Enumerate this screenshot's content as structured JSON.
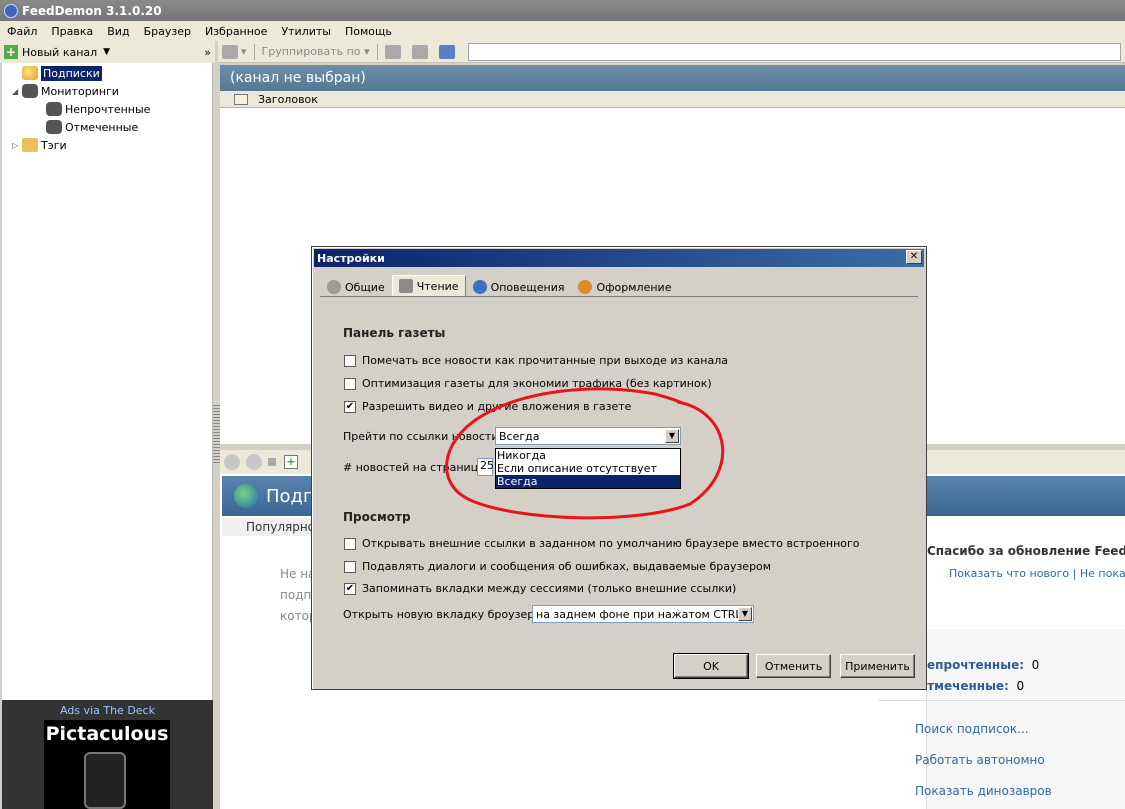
{
  "window": {
    "title": "FeedDemon 3.1.0.20"
  },
  "menu": [
    "Файл",
    "Правка",
    "Вид",
    "Браузер",
    "Избранное",
    "Утилиты",
    "Помощь"
  ],
  "left_toolbar": {
    "new_feed": "Новый канал",
    "chevron": "»"
  },
  "right_toolbar": {
    "group_by": "Группировать по"
  },
  "tree": {
    "subscriptions": "Подписки",
    "watches": "Мониторинги",
    "unread": "Непрочтенные",
    "flagged": "Отмеченные",
    "tags": "Тэги"
  },
  "ads": {
    "label": "Ads via The Deck",
    "title": "Pictaculous"
  },
  "channel_header": "(канал не выбран)",
  "list_header": {
    "column": "Заголовок"
  },
  "browser": {
    "title_partial": "Подп",
    "tab_partial": "Популярное",
    "body_lines": [
      "Не на",
      "подп",
      "котор"
    ],
    "thanks": "Спасибо за обновление FeedD",
    "link_whats_new": "Показать что нового",
    "link_sep": "|",
    "link_dont_show": "Не показыв",
    "stats": {
      "unread_label": "Непрочтенные:",
      "unread_value": "0",
      "flagged_label": "Отмеченные:",
      "flagged_value": "0"
    },
    "links": [
      "Поиск подписок...",
      "Работать автономно",
      "Показать динозавров"
    ]
  },
  "dialog": {
    "title": "Настройки",
    "tabs": [
      "Общие",
      "Чтение",
      "Оповещения",
      "Оформление"
    ],
    "active_tab": "Чтение",
    "section_newspaper": "Панель газеты",
    "checkboxes_newspaper": [
      {
        "label": "Помечать все новости как прочитанные при выходе из канала",
        "checked": false
      },
      {
        "label": "Оптимизация газеты для экономии трафика (без картинок)",
        "checked": false
      },
      {
        "label": "Разрешить видео и другие вложения в газете",
        "checked": true
      }
    ],
    "follow_link_label": "Прейти по ссылки новости",
    "follow_link_value": "Всегда",
    "follow_link_options": [
      "Никогда",
      "Если описание отсутствует",
      "Всегда"
    ],
    "per_page_label": "# новостей на страницу",
    "per_page_value": "25",
    "section_browse": "Просмотр",
    "checkboxes_browse": [
      {
        "label": "Открывать внешние ссылки в заданном по умолчанию браузере вместо встроенного",
        "checked": false
      },
      {
        "label": "Подавлять диалоги и сообщения об ошибках, выдаваемые браузером",
        "checked": false
      },
      {
        "label": "Запоминать вкладки между сессиями (только внешние ссылки)",
        "checked": true
      }
    ],
    "new_tab_label": "Открыть новую вкладку броузера",
    "new_tab_value": "на заднем фоне при нажатом CTRL",
    "buttons": {
      "ok": "OK",
      "cancel": "Отменить",
      "apply": "Применить"
    }
  },
  "colors": {
    "selection": "#0a246a",
    "annotation": "#e8141a"
  }
}
